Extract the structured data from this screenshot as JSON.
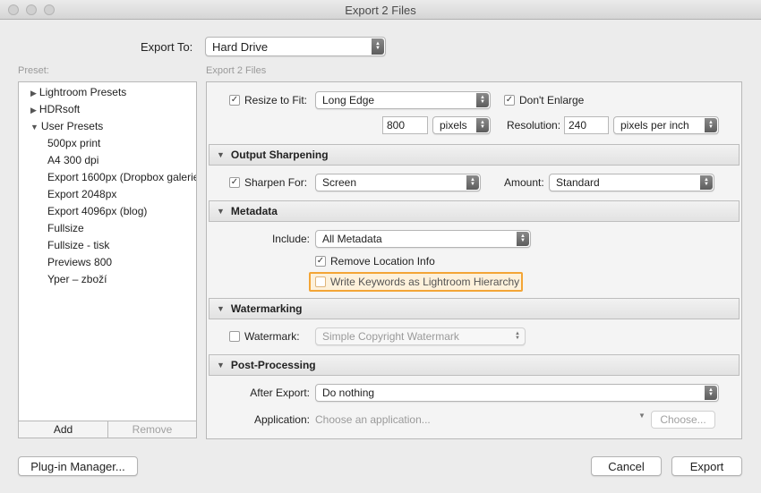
{
  "window": {
    "title": "Export 2 Files"
  },
  "export_to": {
    "label": "Export To:",
    "value": "Hard Drive"
  },
  "preset": {
    "heading": "Preset:",
    "items": [
      {
        "label": "Lightroom Presets",
        "type": "folder",
        "expanded": false
      },
      {
        "label": "HDRsoft",
        "type": "folder",
        "expanded": false
      },
      {
        "label": "User Presets",
        "type": "folder",
        "expanded": true
      },
      {
        "label": "500px print",
        "type": "preset"
      },
      {
        "label": "A4 300 dpi",
        "type": "preset"
      },
      {
        "label": "Export 1600px (Dropbox galerie",
        "type": "preset"
      },
      {
        "label": "Export 2048px",
        "type": "preset"
      },
      {
        "label": "Export 4096px (blog)",
        "type": "preset"
      },
      {
        "label": "Fullsize",
        "type": "preset"
      },
      {
        "label": "Fullsize - tisk",
        "type": "preset"
      },
      {
        "label": "Previews 800",
        "type": "preset"
      },
      {
        "label": "Yper – zboží",
        "type": "preset"
      }
    ],
    "add_label": "Add",
    "remove_label": "Remove"
  },
  "main": {
    "heading": "Export 2 Files",
    "sizing": {
      "resize_label": "Resize to Fit:",
      "resize_checked": true,
      "resize_mode": "Long Edge",
      "dont_enlarge_label": "Don't Enlarge",
      "dont_enlarge_checked": true,
      "size_value": "800",
      "size_unit": "pixels",
      "resolution_label": "Resolution:",
      "resolution_value": "240",
      "resolution_unit": "pixels per inch"
    },
    "output_sharpening": {
      "title": "Output Sharpening",
      "sharpen_label": "Sharpen For:",
      "sharpen_checked": true,
      "sharpen_value": "Screen",
      "amount_label": "Amount:",
      "amount_value": "Standard"
    },
    "metadata": {
      "title": "Metadata",
      "include_label": "Include:",
      "include_value": "All Metadata",
      "remove_location_label": "Remove Location Info",
      "remove_location_checked": true,
      "write_keywords_label": "Write Keywords as Lightroom Hierarchy",
      "write_keywords_checked": false
    },
    "watermarking": {
      "title": "Watermarking",
      "watermark_label": "Watermark:",
      "watermark_checked": false,
      "watermark_value": "Simple Copyright Watermark"
    },
    "post_processing": {
      "title": "Post-Processing",
      "after_export_label": "After Export:",
      "after_export_value": "Do nothing",
      "application_label": "Application:",
      "application_placeholder": "Choose an application...",
      "choose_label": "Choose..."
    }
  },
  "footer": {
    "plugin_manager_label": "Plug-in Manager...",
    "cancel_label": "Cancel",
    "export_label": "Export"
  },
  "colors": {
    "highlight": "#f3a536",
    "background": "#ececec"
  }
}
